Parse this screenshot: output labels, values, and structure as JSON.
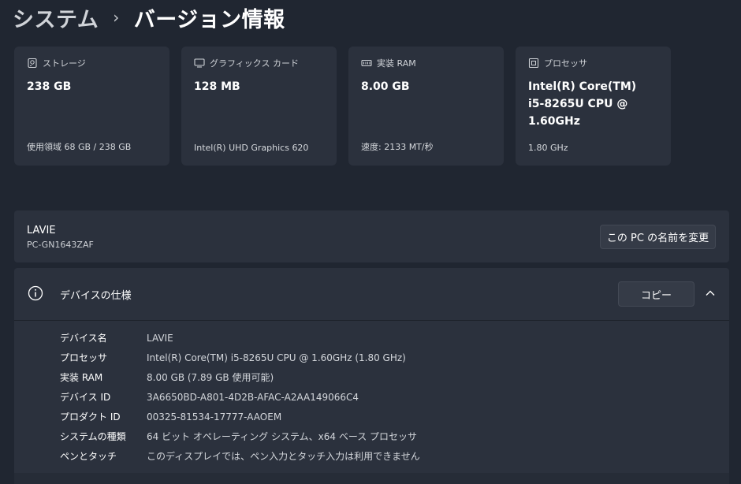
{
  "breadcrumb": {
    "parent": "システム",
    "separator": "›",
    "current": "バージョン情報"
  },
  "cards": {
    "storage": {
      "icon": "storage-icon",
      "label": "ストレージ",
      "value": "238 GB",
      "sub": "使用領域 68 GB / 238 GB"
    },
    "graphics": {
      "icon": "monitor-icon",
      "label": "グラフィックス カード",
      "value": "128 MB",
      "sub": "Intel(R) UHD Graphics 620"
    },
    "ram": {
      "icon": "ram-icon",
      "label": "実装 RAM",
      "value": "8.00 GB",
      "sub": "速度: 2133 MT/秒"
    },
    "processor": {
      "icon": "processor-icon",
      "label": "プロセッサ",
      "value_line1": "Intel(R) Core(TM)",
      "value_line2": "i5-8265U CPU @",
      "value_line3": "1.60GHz",
      "sub": "1.80 GHz"
    }
  },
  "device": {
    "name": "LAVIE",
    "model": "PC-GN1643ZAF",
    "rename_label": "この PC の名前を変更"
  },
  "specs": {
    "title": "デバイスの仕様",
    "copy_label": "コピー",
    "rows": [
      {
        "label": "デバイス名",
        "value": "LAVIE"
      },
      {
        "label": "プロセッサ",
        "value": "Intel(R) Core(TM) i5-8265U CPU @ 1.60GHz (1.80 GHz)"
      },
      {
        "label": "実装 RAM",
        "value": "8.00 GB (7.89 GB 使用可能)"
      },
      {
        "label": "デバイス ID",
        "value": "3A6650BD-A801-4D2B-AFAC-A2AA149066C4"
      },
      {
        "label": "プロダクト ID",
        "value": "00325-81534-17777-AAOEM"
      },
      {
        "label": "システムの種類",
        "value": "64 ビット オペレーティング システム、x64 ベース プロセッサ"
      },
      {
        "label": "ペンとタッチ",
        "value": "このディスプレイでは、ペン入力とタッチ入力は利用できません"
      }
    ]
  },
  "colors": {
    "background": "#202631",
    "card": "#2b313d",
    "button": "#353b47"
  }
}
